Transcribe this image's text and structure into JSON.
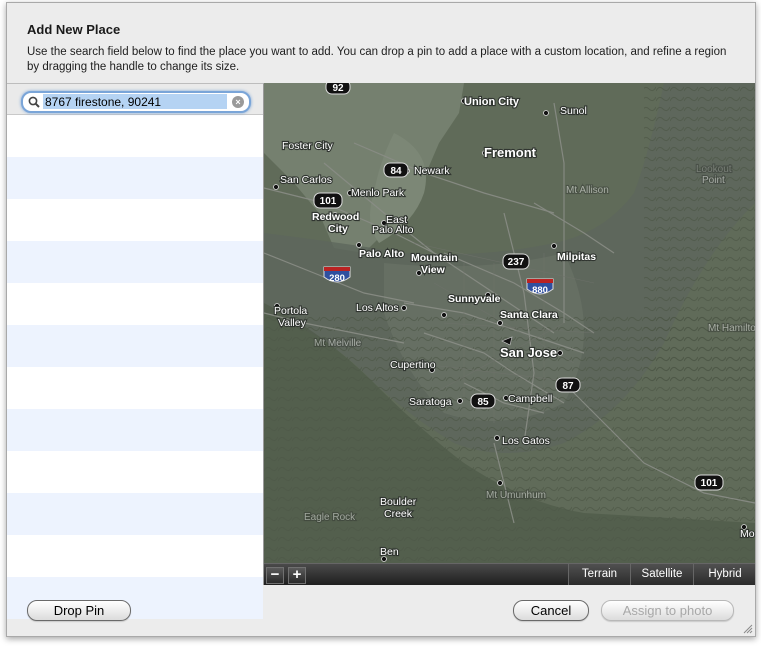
{
  "dialog": {
    "title": "Add New Place",
    "description": "Use the search field below to find the place you want to add. You can drop a pin to add a place with a custom location, and refine a region by dragging the handle to change its size."
  },
  "search": {
    "value": "8767 firestone, 90241",
    "icon": "magnifier-icon",
    "clear_icon": "clear-icon"
  },
  "map": {
    "labels": [
      {
        "name": "place",
        "text": "Union City"
      },
      {
        "name": "place",
        "text": "Sunol"
      },
      {
        "name": "place",
        "text": "Foster City"
      },
      {
        "name": "place",
        "text": "Fremont"
      },
      {
        "name": "place",
        "text": "Newark"
      },
      {
        "name": "place",
        "text": "San Carlos"
      },
      {
        "name": "place",
        "text": "Menlo Park"
      },
      {
        "name": "place",
        "text": "Redwood"
      },
      {
        "name": "place",
        "text": "City"
      },
      {
        "name": "place",
        "text": "East"
      },
      {
        "name": "place",
        "text": "Palo Alto"
      },
      {
        "name": "place",
        "text": "Palo Alto"
      },
      {
        "name": "place",
        "text": "Mountain"
      },
      {
        "name": "place",
        "text": "View"
      },
      {
        "name": "place",
        "text": "Milpitas"
      },
      {
        "name": "place",
        "text": "Lookout"
      },
      {
        "name": "place",
        "text": "Point"
      },
      {
        "name": "place",
        "text": "Mt Allison"
      },
      {
        "name": "place",
        "text": "Los Altos"
      },
      {
        "name": "place",
        "text": "Sunnyvale"
      },
      {
        "name": "place",
        "text": "Santa Clara"
      },
      {
        "name": "place",
        "text": "Portola"
      },
      {
        "name": "place",
        "text": "Valley"
      },
      {
        "name": "place",
        "text": "Mt Melville"
      },
      {
        "name": "place",
        "text": "San Jose"
      },
      {
        "name": "place",
        "text": "Mt Hamilto"
      },
      {
        "name": "place",
        "text": "Cupertino"
      },
      {
        "name": "place",
        "text": "Saratoga"
      },
      {
        "name": "place",
        "text": "Campbell"
      },
      {
        "name": "place",
        "text": "Los Gatos"
      },
      {
        "name": "place",
        "text": "Boulder"
      },
      {
        "name": "place",
        "text": "Creek"
      },
      {
        "name": "place",
        "text": "Mt Umunhum"
      },
      {
        "name": "place",
        "text": "Eagle Rock"
      },
      {
        "name": "place",
        "text": "Ben"
      },
      {
        "name": "place",
        "text": "Mo"
      }
    ],
    "shields": [
      "92",
      "84",
      "101",
      "237",
      "280",
      "880",
      "85",
      "87",
      "101"
    ],
    "zoom_out": "−",
    "zoom_in": "+",
    "types": [
      "Terrain",
      "Satellite",
      "Hybrid"
    ]
  },
  "buttons": {
    "drop_pin": "Drop Pin",
    "cancel": "Cancel",
    "assign": "Assign to photo"
  }
}
